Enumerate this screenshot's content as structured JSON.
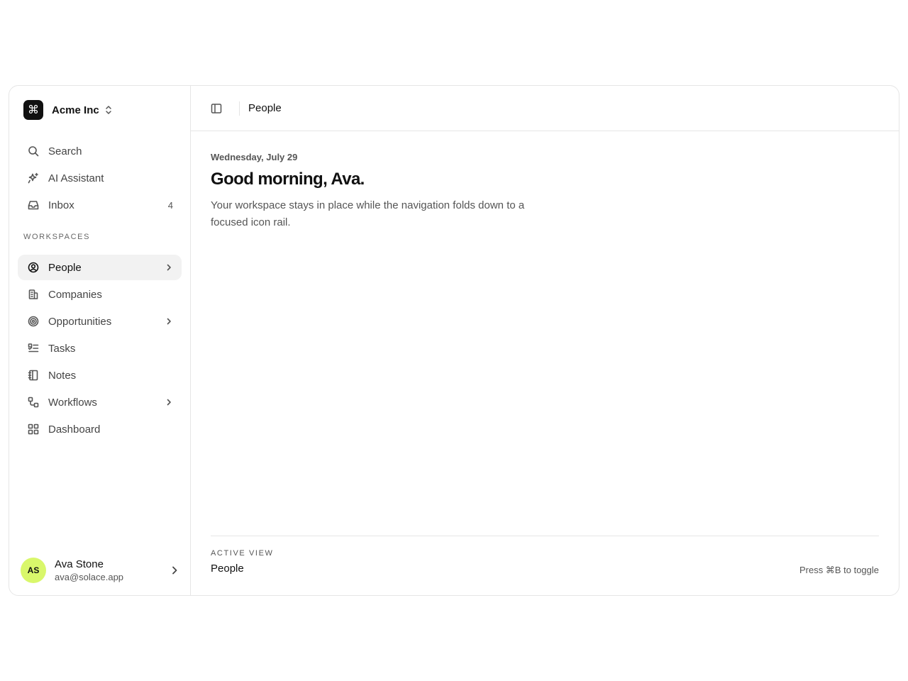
{
  "workspace": {
    "name": "Acme Inc",
    "logo_icon": "command-icon"
  },
  "nav_top": [
    {
      "label": "Search",
      "icon": "search-icon"
    },
    {
      "label": "AI Assistant",
      "icon": "sparkles-icon"
    },
    {
      "label": "Inbox",
      "icon": "inbox-icon",
      "badge": "4"
    }
  ],
  "section_label": "Workspaces",
  "nav_workspaces": [
    {
      "label": "People",
      "icon": "user-circle-icon",
      "active": true,
      "has_chevron": true
    },
    {
      "label": "Companies",
      "icon": "building-icon"
    },
    {
      "label": "Opportunities",
      "icon": "target-icon",
      "has_chevron": true
    },
    {
      "label": "Tasks",
      "icon": "checklist-icon"
    },
    {
      "label": "Notes",
      "icon": "notebook-icon"
    },
    {
      "label": "Workflows",
      "icon": "workflow-icon",
      "has_chevron": true
    },
    {
      "label": "Dashboard",
      "icon": "dashboard-icon"
    }
  ],
  "user": {
    "initials": "AS",
    "name": "Ava Stone",
    "email": "ava@solace.app",
    "avatar_color": "#d9f76b"
  },
  "header": {
    "title": "People"
  },
  "main": {
    "date": "Wednesday, July 29",
    "greeting": "Good morning, Ava.",
    "description": "Your workspace stays in place while the navigation folds down to a focused icon rail."
  },
  "footer": {
    "label": "Active view",
    "value": "People",
    "hint": "Press ⌘B to toggle"
  }
}
